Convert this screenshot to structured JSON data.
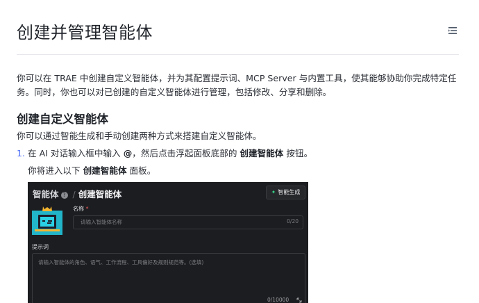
{
  "page": {
    "title": "创建并管理智能体"
  },
  "intro": "你可以在 TRAE 中创建自定义智能体，并为其配置提示词、MCP Server 与内置工具，使其能够协助你完成特定任务。同时，你也可以对已创建的自定义智能体进行管理，包括修改、分享和删除。",
  "section": {
    "title": "创建自定义智能体",
    "desc": "你可以通过智能生成和手动创建两种方式来搭建自定义智能体。"
  },
  "step1": {
    "num": "1.",
    "pre": "在 AI 对话输入框中输入 ",
    "at": "@",
    "mid": "，然后点击浮起面板底部的 ",
    "bold": "创建智能体",
    "post": " 按钮。"
  },
  "step1_sub": {
    "pre": "你将进入以下 ",
    "bold": "创建智能体",
    "post": " 面板。"
  },
  "shot": {
    "crumb_root": "智能体",
    "crumb_sep": "/",
    "crumb_current": "创建智能体",
    "gen_button": "智能生成",
    "name_label": "名称",
    "required_mark": "*",
    "name_placeholder": "请输入智能体名称",
    "name_count": "0/20",
    "prompt_label": "提示词",
    "prompt_placeholder": "请输入智能体的角色、语气、工作流程、工具偏好及规则规范等。(选填)",
    "prompt_count": "0/10000"
  },
  "icons": {
    "toc": "toc-list-icon",
    "help": "question-circle-icon",
    "spark": "sparkle-icon",
    "avatar": "robot-avatar-icon",
    "resize": "expand-icon"
  },
  "colors": {
    "link": "#4a6cf7",
    "panel_bg": "#1c1d20",
    "spark": "#39d58a",
    "required": "#f05c5c"
  }
}
